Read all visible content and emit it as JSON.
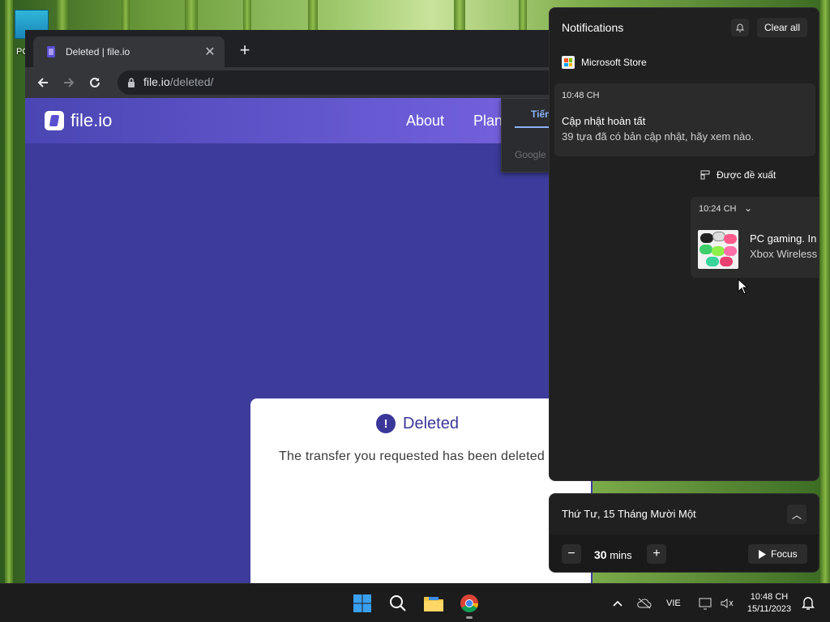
{
  "desktop": {
    "icon_label": "PC"
  },
  "browser": {
    "tab_title": "Deleted | file.io",
    "new_tab": "+",
    "url_host": "file.io",
    "url_path": "/deleted/",
    "page": {
      "logo_text": "file.io",
      "nav": [
        "About",
        "Plan"
      ],
      "translate_tab": "Tiến",
      "translate_google": "Google",
      "card_title": "Deleted",
      "card_message": "The transfer you requested has been deleted"
    }
  },
  "notifications": {
    "header": "Notifications",
    "clear_all": "Clear all",
    "app_name": "Microsoft Store",
    "toast": {
      "time": "10:48 CH",
      "title": "Cập nhật hoàn tất",
      "body": "39 tựa đã có bản cập nhật, hãy xem nào."
    },
    "suggested_label": "Được đề xuất",
    "toast2": {
      "time": "10:24 CH",
      "title": "PC gaming. In",
      "body": "Xbox Wireless"
    }
  },
  "calendar": {
    "date": "Thứ Tư, 15 Tháng Mười Một",
    "minutes_value": "30",
    "minutes_unit": "mins",
    "focus_label": "Focus"
  },
  "taskbar": {
    "language": "VIE",
    "time": "10:48 CH",
    "date": "15/11/2023"
  },
  "colors": {
    "page_bg": "#3d3c9c",
    "accent": "#3b3799",
    "panel_bg": "#202020"
  }
}
